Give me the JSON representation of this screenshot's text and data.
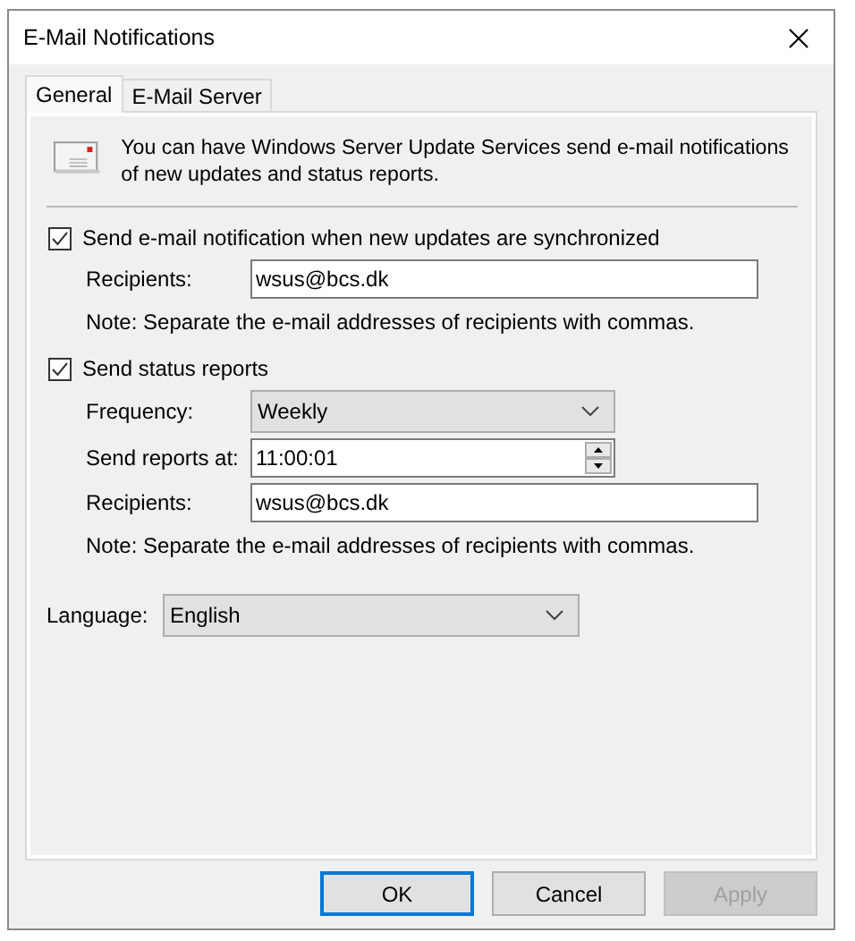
{
  "window": {
    "title": "E-Mail Notifications"
  },
  "tabs": [
    {
      "label": "General",
      "selected": true
    },
    {
      "label": "E-Mail Server",
      "selected": false
    }
  ],
  "intro": "You can have Windows Server Update Services send e-mail notifications of new updates and status reports.",
  "sync_notification": {
    "label": "Send e-mail notification when new updates are synchronized",
    "checked": true,
    "recipients_label": "Recipients:",
    "recipients": "wsus@bcs.dk",
    "note": "Note: Separate the e-mail addresses of recipients with commas."
  },
  "status_reports": {
    "label": "Send status reports",
    "checked": true,
    "frequency_label": "Frequency:",
    "frequency": "Weekly",
    "time_label": "Send reports at:",
    "time": "11:00:01",
    "recipients_label": "Recipients:",
    "recipients": "wsus@bcs.dk",
    "note": "Note: Separate the e-mail addresses of recipients with commas."
  },
  "language": {
    "label": "Language:",
    "value": "English"
  },
  "buttons": [
    {
      "label": "OK",
      "default": true,
      "disabled": false
    },
    {
      "label": "Cancel",
      "default": false,
      "disabled": false
    },
    {
      "label": "Apply",
      "default": false,
      "disabled": true
    }
  ]
}
